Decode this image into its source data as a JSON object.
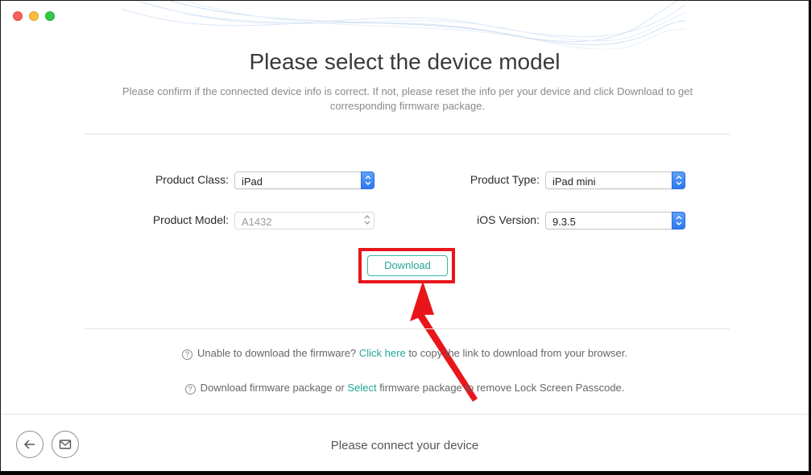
{
  "window": {
    "title": "Please select the device model",
    "subtitle_line1": "Please confirm if the connected device info is correct. If not, please reset the info per your device and click Download to get",
    "subtitle_line2": "corresponding firmware package."
  },
  "form": {
    "product_class": {
      "label": "Product Class:",
      "value": "iPad"
    },
    "product_type": {
      "label": "Product Type:",
      "value": "iPad mini"
    },
    "product_model": {
      "label": "Product Model:",
      "value": "A1432"
    },
    "ios_version": {
      "label": "iOS Version:",
      "value": "9.3.5"
    }
  },
  "download_label": "Download",
  "help": {
    "line1_pre": "Unable to download the firmware?",
    "line1_link": "Click here",
    "line1_post": "to copy the link to download from your browser.",
    "line2_pre": "Download firmware package or",
    "line2_link": "Select",
    "line2_post": "firmware package to remove Lock Screen Passcode."
  },
  "status_text": "Please connect your device",
  "colors": {
    "accent": "#27a595",
    "highlight": "#e8161b",
    "select_blue": "#2b78f0"
  },
  "icons": {
    "back": "back-arrow-icon",
    "mail": "mail-icon",
    "help": "question-circle-icon"
  }
}
